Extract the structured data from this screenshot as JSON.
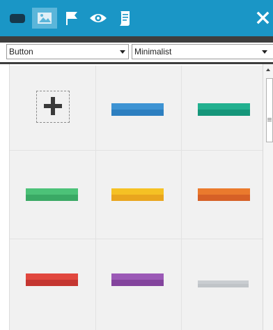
{
  "toolbar": {
    "icons": [
      "layout-icon",
      "image-icon",
      "flag-icon",
      "eye-icon",
      "document-icon"
    ],
    "active_icon": "image-icon",
    "close_icon": "close-icon",
    "background": "#1a96c6"
  },
  "filters": {
    "type_select": {
      "value": "Button"
    },
    "style_select": {
      "value": "Minimalist"
    }
  },
  "gallery": {
    "add_item": "plus-icon",
    "swatches": [
      {
        "name": "blue",
        "top": "#3d93d3",
        "bottom": "#2d7fc0"
      },
      {
        "name": "teal",
        "top": "#22b08f",
        "bottom": "#16967a"
      },
      {
        "name": "green",
        "top": "#4cc278",
        "bottom": "#3aa965"
      },
      {
        "name": "yellow",
        "top": "#f5c124",
        "bottom": "#e9a51e"
      },
      {
        "name": "orange",
        "top": "#ea7a2d",
        "bottom": "#d66026"
      },
      {
        "name": "red",
        "top": "#e1473e",
        "bottom": "#c43631"
      },
      {
        "name": "purple",
        "top": "#9b59b6",
        "bottom": "#83449d"
      },
      {
        "name": "light-gray",
        "top": "#c9cdd1",
        "bottom": "#c0c4c8"
      }
    ]
  }
}
